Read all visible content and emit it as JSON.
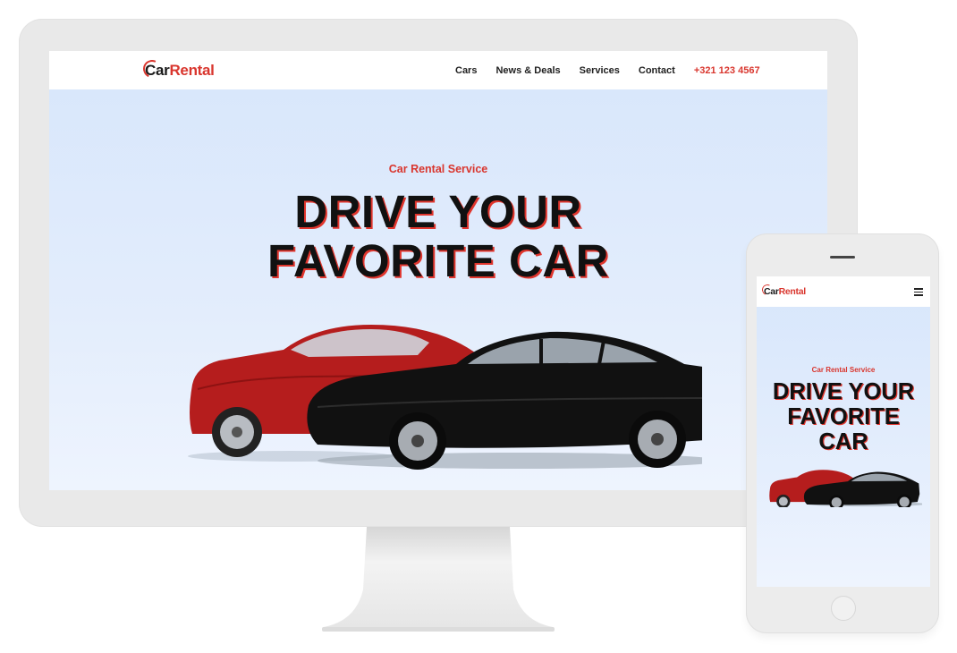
{
  "brand": {
    "name_part1": "Car",
    "name_part2": "Rental",
    "accent": "#d9362e",
    "dark": "#111111"
  },
  "nav": {
    "items": [
      {
        "label": "Cars"
      },
      {
        "label": "News & Deals"
      },
      {
        "label": "Services"
      },
      {
        "label": "Contact"
      }
    ],
    "phone": "+321 123 4567"
  },
  "hero": {
    "subtitle": "Car Rental Service",
    "title_line1": "DRIVE YOUR",
    "title_line2": "FAVORITE CAR"
  },
  "mobile": {
    "subtitle": "Car Rental Service",
    "title_line1": "DRIVE YOUR",
    "title_line2": "FAVORITE",
    "title_line3": "CAR",
    "menu_icon": "hamburger-icon"
  },
  "images": {
    "cars": "red-and-black-sedans"
  }
}
